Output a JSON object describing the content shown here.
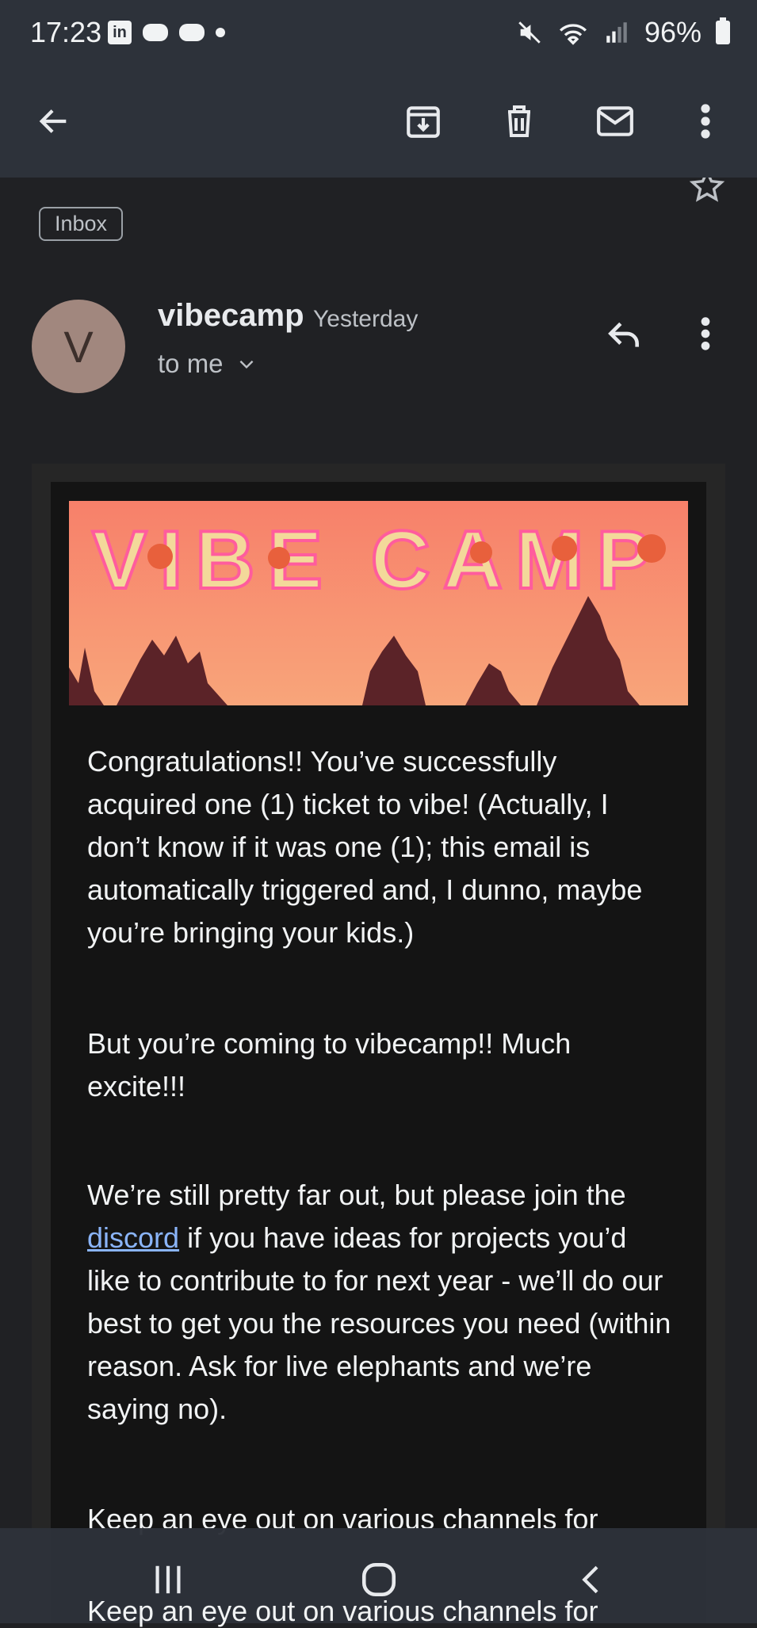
{
  "status_bar": {
    "time": "17:23",
    "linkedin_icon": "in",
    "battery": "96%"
  },
  "toolbar": {
    "icons": [
      "back-arrow-icon",
      "archive-icon",
      "delete-icon",
      "mark-unread-icon",
      "more-vert-icon"
    ]
  },
  "message": {
    "label": "Inbox",
    "sender_initial": "V",
    "sender": "vibecamp",
    "date": "Yesterday",
    "recipient": "to me"
  },
  "email_body": {
    "banner_title": "VIBE CAMP",
    "p1": "Congratulations!! You’ve successfully acquired one (1) ticket to vibe! (Actually, I don’t know if it was one (1); this email is automatically triggered and, I dunno, maybe you’re bringing your kids.)",
    "p2": "But you’re coming to vibecamp!! Much excite!!!",
    "p3_link": "discord",
    "p3_before": "We’re still pretty far out, but please join the ",
    "p3_after": " if you have ideas for projects you’d like to contribute to for next year - we’ll do our best to get you the resources you need (within reason. Ask for live elephants and we’re saying no).",
    "p4": "Keep an eye out on various channels for",
    "p4_under_nav": "Keep an eye out on various channels for"
  },
  "nav_bar": {
    "icons": [
      "recent-apps-icon",
      "home-icon",
      "back-icon"
    ]
  },
  "colors": {
    "background": "#202124",
    "appbar": "#2d323a",
    "email_bg": "#141414",
    "link": "#8ab4f8",
    "avatar": "#a1877e"
  }
}
